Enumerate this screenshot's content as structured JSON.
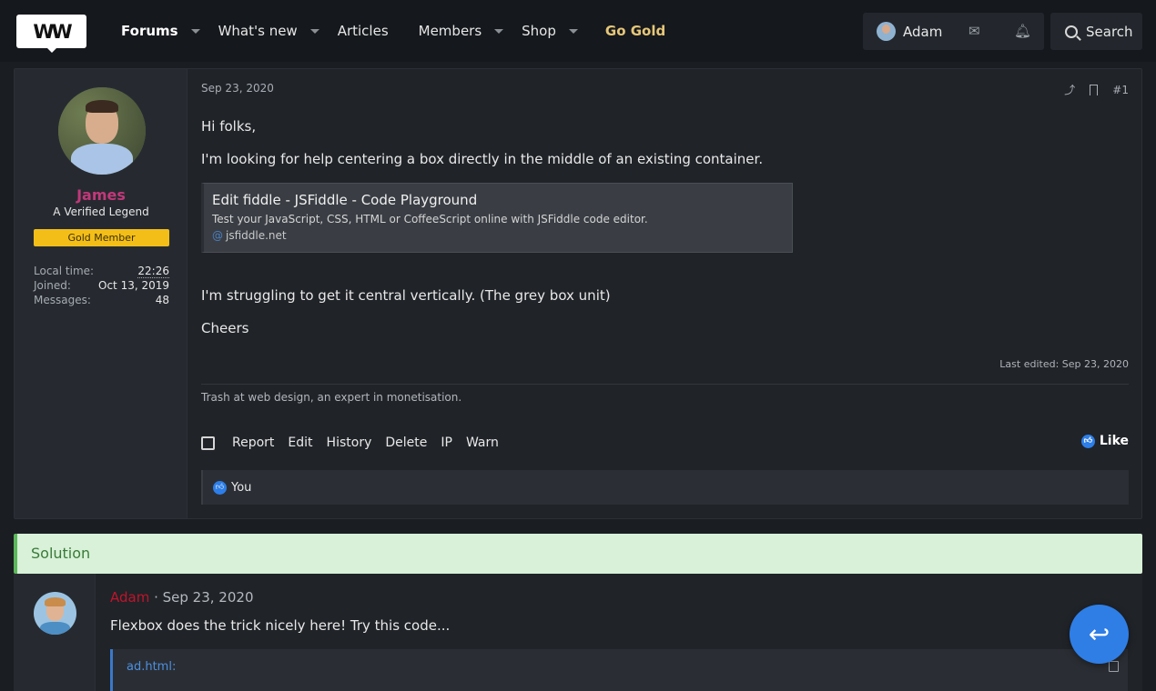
{
  "nav": {
    "logo": "WW",
    "items": [
      {
        "label": "Forums",
        "caret": true,
        "bold": true
      },
      {
        "label": "What's new",
        "caret": true
      },
      {
        "label": "Articles",
        "caret": false
      },
      {
        "label": "Members",
        "caret": true
      },
      {
        "label": "Shop",
        "caret": true
      },
      {
        "label": "Go Gold",
        "caret": false,
        "gold": true
      }
    ],
    "user": "Adam",
    "search": "Search"
  },
  "post1": {
    "author": "James",
    "title": "A Verified Legend",
    "badge": "Gold Member",
    "stats": [
      {
        "k": "Local time:",
        "v": "22:26"
      },
      {
        "k": "Joined:",
        "v": "Oct 13, 2019"
      },
      {
        "k": "Messages:",
        "v": "48"
      }
    ],
    "date": "Sep 23, 2020",
    "number": "#1",
    "lines": [
      "Hi folks,",
      "I'm looking for help centering a box directly in the middle of an existing container.",
      "I'm struggling to get it central vertically. (The grey box unit)",
      "Cheers"
    ],
    "embed": {
      "title": "Edit fiddle - JSFiddle - Code Playground",
      "desc": "Test your JavaScript, CSS, HTML or CoffeeScript online with JSFiddle code editor.",
      "link": "jsfiddle.net"
    },
    "last_edited": "Last edited: Sep 23, 2020",
    "signature": "Trash at web design, an expert in monetisation.",
    "actions": [
      "Report",
      "Edit",
      "History",
      "Delete",
      "IP",
      "Warn"
    ],
    "like": "Like",
    "likes_by": "You"
  },
  "solution": {
    "label": "Solution",
    "author": "Adam",
    "date": "· Sep 23, 2020",
    "text": "Flexbox does the trick nicely here! Try this code...",
    "code_label": "ad.html:"
  },
  "colors": {
    "accent": "#2e7ee6",
    "gold": "#f4be19",
    "author_pink": "#c2387a",
    "solution_bg": "#d8f1d8"
  }
}
